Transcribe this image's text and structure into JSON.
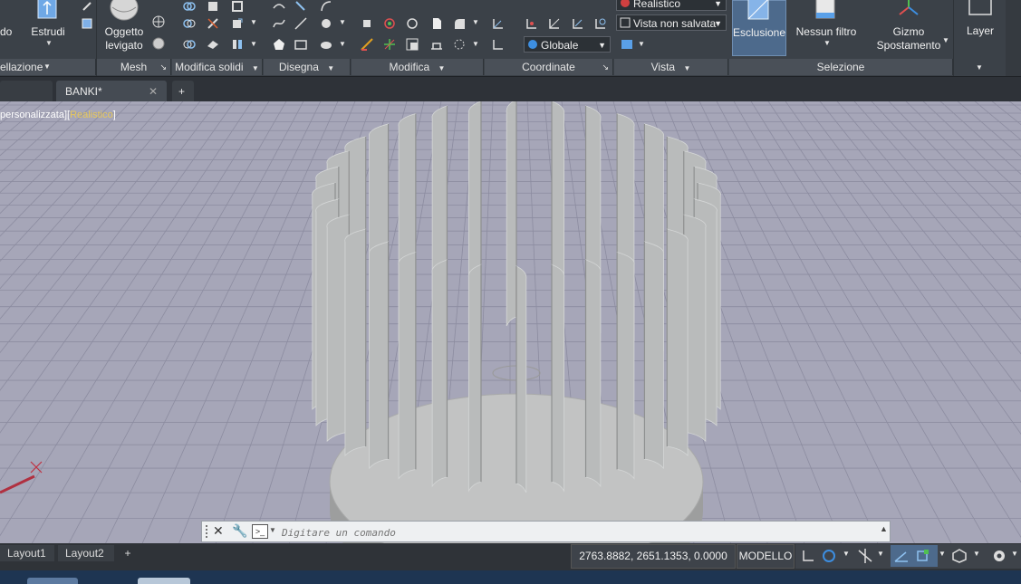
{
  "ribbon": {
    "clipped_left_button": "do",
    "extrude_label": "Estrudi",
    "smooth_object_label1": "Oggetto",
    "smooth_object_label2": "levigato",
    "visual_style": "Realistico",
    "view_unsaved": "Vista non salvata",
    "ucs_world": "Globale",
    "exclude_label": "Esclusione",
    "no_filter_label": "Nessun filtro",
    "gizmo_label1": "Gizmo",
    "gizmo_label2": "Spostamento",
    "layer_label": "Layer",
    "panels": {
      "modeling": "ellazione",
      "mesh": "Mesh",
      "solid_edit": "Modifica solidi",
      "draw": "Disegna",
      "modify": "Modifica",
      "coordinates": "Coordinate",
      "view": "Vista",
      "selection": "Selezione"
    }
  },
  "tabs": {
    "active": "BANKI*",
    "new_tab_symbol": "+"
  },
  "viewport": {
    "label_main": "personalizzata",
    "label_style": "Realistico",
    "label_prefix_bracket": "][",
    "label_suffix_bracket": "]"
  },
  "command": {
    "placeholder": "Digitare un comando"
  },
  "layouts": {
    "tab1": "Layout1",
    "tab2": "Layout2",
    "add": "+"
  },
  "status": {
    "coordinates": "2763.8882, 2651.1353, 0.0000",
    "space": "MODELLO"
  },
  "colors": {
    "ribbon_bg": "#3b4148",
    "viewport_bg": "#a6a6b8",
    "grid_line": "#8c8ca0",
    "blade_fill": "#b9bbbb",
    "accent_blue": "#3d8ee0",
    "active_button_bg": "#4d6a8c"
  }
}
